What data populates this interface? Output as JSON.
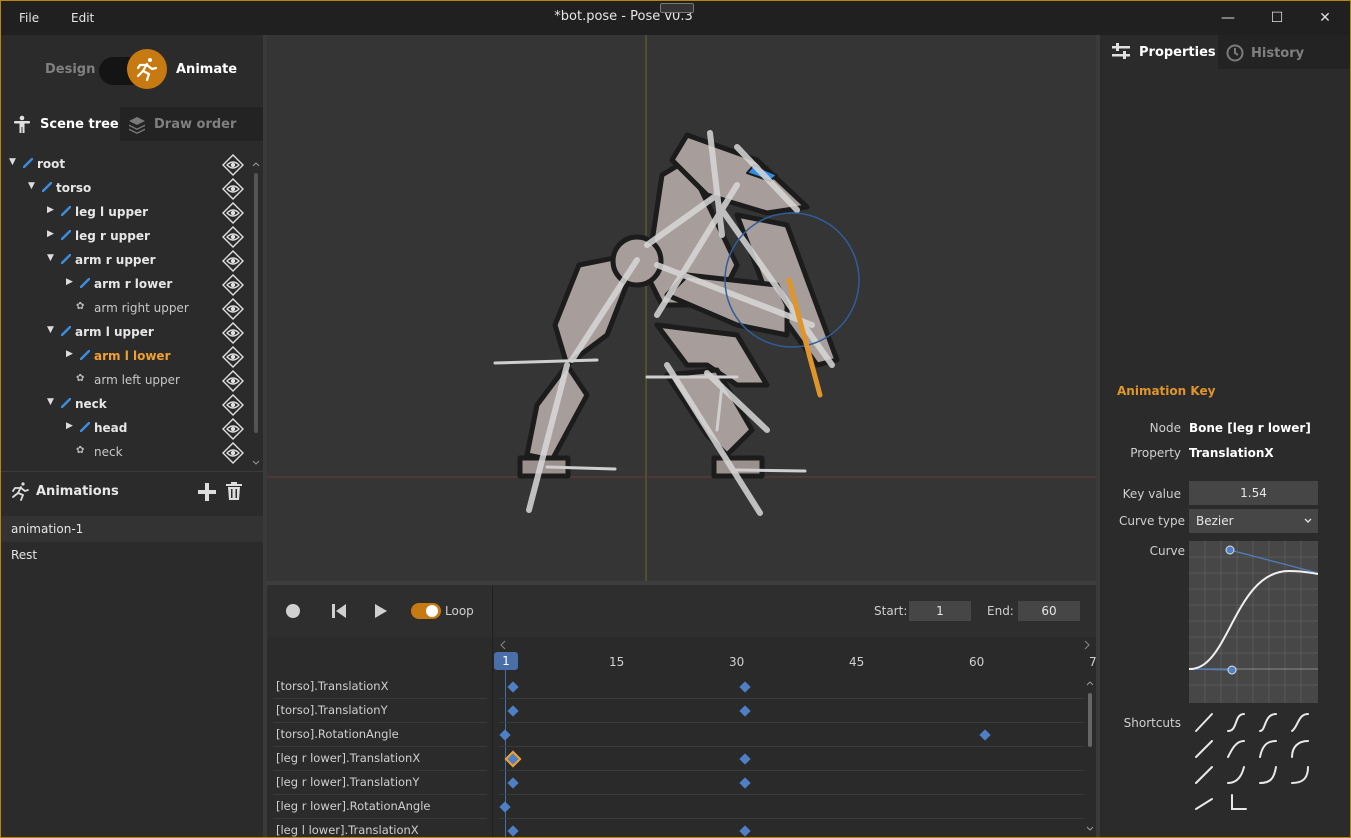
{
  "window": {
    "title": "*bot.pose - Pose v0.3",
    "menu": [
      "File",
      "Edit"
    ],
    "controls": {
      "minimize": "—",
      "maximize": "☐",
      "close": "✕"
    }
  },
  "mode": {
    "design_label": "Design",
    "animate_label": "Animate",
    "active": "Animate"
  },
  "left_tabs": {
    "scene_tree": "Scene tree",
    "draw_order": "Draw order"
  },
  "scene_tree": [
    {
      "label": "root",
      "type": "bone",
      "expanded": true,
      "depth": 0
    },
    {
      "label": "torso",
      "type": "bone",
      "expanded": true,
      "depth": 1
    },
    {
      "label": "leg l upper",
      "type": "bone",
      "expanded": false,
      "depth": 2
    },
    {
      "label": "leg r upper",
      "type": "bone",
      "expanded": false,
      "depth": 2
    },
    {
      "label": "arm r upper",
      "type": "bone",
      "expanded": true,
      "depth": 2
    },
    {
      "label": "arm r lower",
      "type": "bone",
      "expanded": false,
      "depth": 3
    },
    {
      "label": "arm right upper",
      "type": "sprite",
      "depth": 3
    },
    {
      "label": "arm l upper",
      "type": "bone",
      "expanded": true,
      "depth": 2
    },
    {
      "label": "arm l lower",
      "type": "bone",
      "expanded": false,
      "depth": 3,
      "selected": true
    },
    {
      "label": "arm left upper",
      "type": "sprite",
      "depth": 3
    },
    {
      "label": "neck",
      "type": "bone",
      "expanded": true,
      "depth": 2
    },
    {
      "label": "head",
      "type": "bone",
      "expanded": false,
      "depth": 3
    },
    {
      "label": "neck",
      "type": "sprite",
      "depth": 3
    }
  ],
  "animations": {
    "title": "Animations",
    "items": [
      {
        "label": "animation-1",
        "selected": true
      },
      {
        "label": "Rest",
        "selected": false
      }
    ]
  },
  "timeline": {
    "loop_label": "Loop",
    "loop_on": true,
    "start_label": "Start:",
    "start_value": "1",
    "end_label": "End:",
    "end_value": "60",
    "current_frame": "1",
    "ruler_labels": [
      "15",
      "30",
      "45",
      "60",
      "7"
    ],
    "tracks": [
      {
        "label": "[torso].TranslationX",
        "keys": [
          1,
          30
        ]
      },
      {
        "label": "[torso].TranslationY",
        "keys": [
          1,
          30
        ]
      },
      {
        "label": "[torso].RotationAngle",
        "keys": [
          0,
          60
        ]
      },
      {
        "label": "[leg r lower].TranslationX",
        "keys": [
          1,
          30
        ],
        "selected_key": 1
      },
      {
        "label": "[leg r lower].TranslationY",
        "keys": [
          1,
          30
        ]
      },
      {
        "label": "[leg r lower].RotationAngle",
        "keys": [
          0
        ]
      },
      {
        "label": "[leg l lower].TranslationX",
        "keys": [
          1,
          30
        ]
      }
    ]
  },
  "right_tabs": {
    "properties": "Properties",
    "history": "History"
  },
  "animation_key": {
    "title": "Animation Key",
    "node_label": "Node",
    "node_value": "Bone [leg r lower]",
    "property_label": "Property",
    "property_value": "TranslationX",
    "key_value_label": "Key value",
    "key_value": "1.54",
    "curve_type_label": "Curve type",
    "curve_type_value": "Bezier",
    "curve_label": "Curve",
    "shortcuts_label": "Shortcuts"
  },
  "colors": {
    "accent": "#c87a12",
    "selection_orange": "#f0a030",
    "key_blue": "#4f7fc4",
    "bone_blue": "#3c8dde",
    "frame_marker": "#4a6fa8"
  }
}
